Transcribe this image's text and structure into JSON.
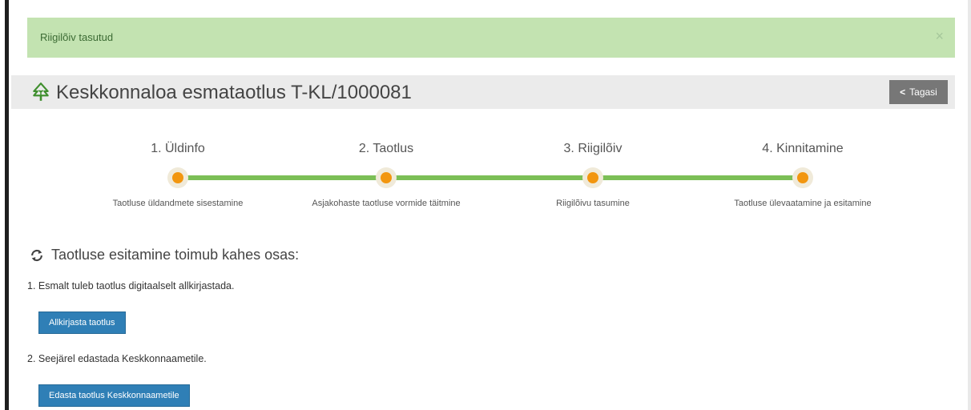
{
  "alert": {
    "text": "Riigilõiv tasutud",
    "close_symbol": "×"
  },
  "header": {
    "title": "Keskkonnaloa esmataotlus T-KL/1000081",
    "icon": "tree-icon",
    "back_label": "Tagasi",
    "back_icon": "chevron-left-icon"
  },
  "steps": [
    {
      "title": "1. Üldinfo",
      "description": "Taotluse üldandmete sisestamine"
    },
    {
      "title": "2. Taotlus",
      "description": "Asjakohaste taotluse vormide täitmine"
    },
    {
      "title": "3. Riigilõiv",
      "description": "Riigilõivu tasumine"
    },
    {
      "title": "4. Kinnitamine",
      "description": "Taotluse ülevaatamine ja esitamine"
    }
  ],
  "section": {
    "title": "Taotluse esitamine toimub kahes osas:",
    "icon": "refresh-icon",
    "step1_text": "1. Esmalt tuleb taotlus digitaalselt allkirjastada.",
    "sign_button": "Allkirjasta taotlus",
    "step2_text": "2. Seejärel edastada Keskkonnaametile.",
    "forward_button": "Edasta taotlus Keskkonnaametile"
  },
  "colors": {
    "alert_bg": "#c3e3b1",
    "progress_line": "#7cbf56",
    "step_dot": "#f2960f",
    "primary_button": "#2f7fb6",
    "back_button": "#777777",
    "tree_icon": "#3f8f2e"
  }
}
